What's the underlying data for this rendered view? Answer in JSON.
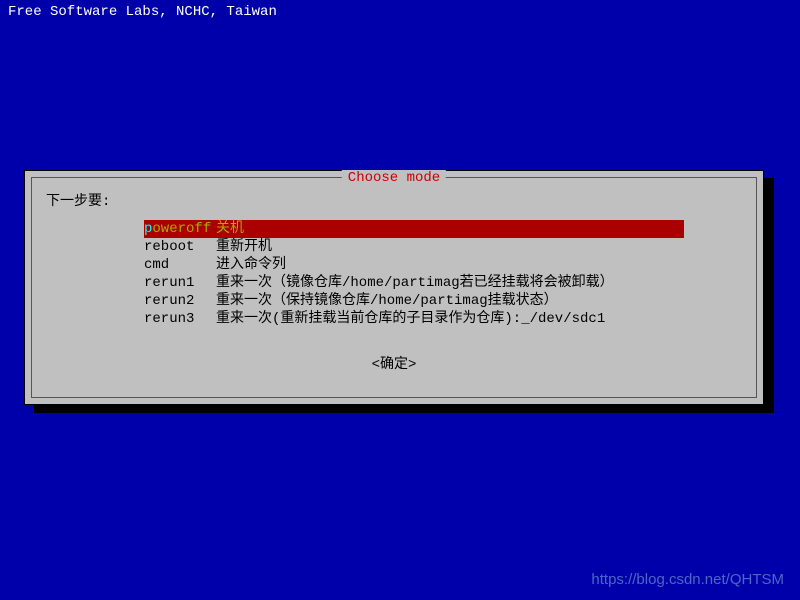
{
  "header": {
    "text": "Free Software Labs, NCHC, Taiwan"
  },
  "dialog": {
    "title": "Choose mode",
    "prompt": "下一步要:",
    "items": [
      {
        "key": "poweroff",
        "desc": "关机",
        "selected": true
      },
      {
        "key": "reboot",
        "desc": "重新开机",
        "selected": false
      },
      {
        "key": "cmd",
        "desc": "进入命令列",
        "selected": false
      },
      {
        "key": "rerun1",
        "desc": "重来一次（镜像仓库/home/partimag若已经挂载将会被卸载）",
        "selected": false
      },
      {
        "key": "rerun2",
        "desc": "重来一次（保持镜像仓库/home/partimag挂载状态）",
        "selected": false
      },
      {
        "key": "rerun3",
        "desc": "重来一次(重新挂载当前仓库的子目录作为仓库):_/dev/sdc1",
        "selected": false
      }
    ],
    "ok_label": "<确定>"
  },
  "watermark": {
    "text": "https://blog.csdn.net/QHTSM"
  }
}
